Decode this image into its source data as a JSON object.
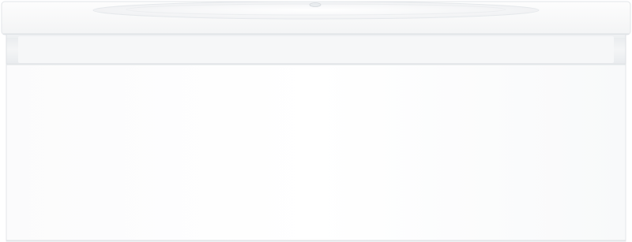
{
  "product": {
    "name": "",
    "finish_color": "#ffffff",
    "shadow_color": "#e6e9ec",
    "edge_color": "#d9dde1"
  }
}
